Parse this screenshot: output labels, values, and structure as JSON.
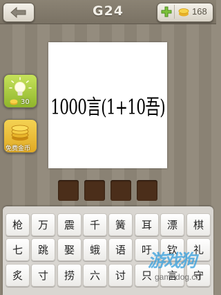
{
  "header": {
    "level": "G24",
    "coins": "168"
  },
  "puzzle": {
    "clue": "1000言(1+10吾)"
  },
  "sidebar": {
    "hint_cost": "30",
    "free_coins_label": "免费金币"
  },
  "answer": {
    "slot_count": 4
  },
  "keyboard": {
    "rows": [
      [
        "枪",
        "万",
        "震",
        "千",
        "簧",
        "耳",
        "漂",
        "棋"
      ],
      [
        "七",
        "跳",
        "娶",
        "蛾",
        "语",
        "吁",
        "钦",
        "礼"
      ],
      [
        "炙",
        "寸",
        "捞",
        "六",
        "讨",
        "只",
        "言",
        "守"
      ]
    ]
  },
  "watermark": {
    "main": "游戏狗",
    "sub": "gamedog.cn"
  },
  "colors": {
    "slot": "#4b2e1a",
    "hint_green": "#a9cc3e",
    "coin_gold": "#f2c236"
  }
}
